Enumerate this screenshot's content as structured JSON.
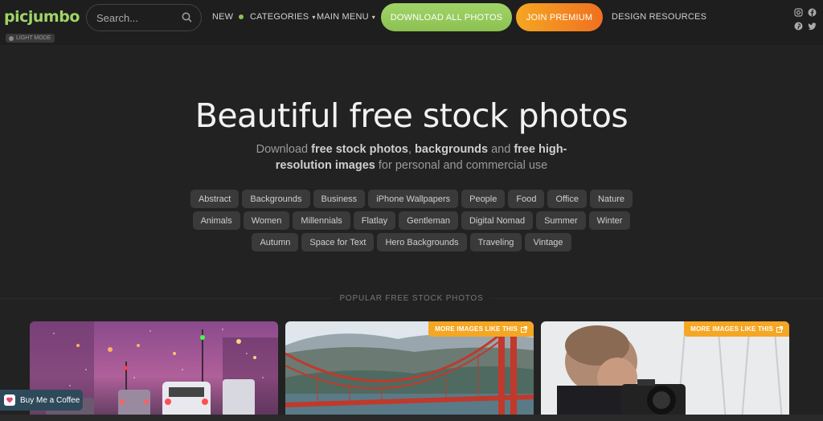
{
  "header": {
    "logo": "picjumbo",
    "mode_label": "LIGHT MODE",
    "search_placeholder": "Search...",
    "nav": {
      "new": "NEW",
      "categories": "CATEGORIES",
      "main_menu": "MAIN MENU",
      "download_all": "DOWNLOAD ALL PHOTOS",
      "join_premium": "JOIN PREMIUM",
      "design_resources": "DESIGN RESOURCES"
    },
    "social_icons": [
      "instagram-icon",
      "facebook-icon",
      "pinterest-icon",
      "twitter-icon"
    ]
  },
  "hero": {
    "title": "Beautiful free stock photos",
    "sub_1": "Download ",
    "sub_2": "free stock photos",
    "sub_3": ", ",
    "sub_4": "backgrounds",
    "sub_5": " and ",
    "sub_6": "free high-resolution images",
    "sub_7": " for personal and commercial use"
  },
  "tags": [
    "Abstract",
    "Backgrounds",
    "Business",
    "iPhone Wallpapers",
    "People",
    "Food",
    "Office",
    "Nature",
    "Animals",
    "Women",
    "Millennials",
    "Flatlay",
    "Gentleman",
    "Digital Nomad",
    "Summer",
    "Winter",
    "Autumn",
    "Space for Text",
    "Hero Backgrounds",
    "Traveling",
    "Vintage"
  ],
  "section_title": "POPULAR FREE STOCK PHOTOS",
  "cards": [
    {
      "badge": ""
    },
    {
      "badge": "MORE IMAGES LIKE THIS"
    },
    {
      "badge": "MORE IMAGES LIKE THIS"
    }
  ],
  "coffee_label": "Buy Me a Coffee",
  "colors": {
    "background": "#222222",
    "accent_green": "#8cc152",
    "accent_orange": "#f5a623"
  }
}
